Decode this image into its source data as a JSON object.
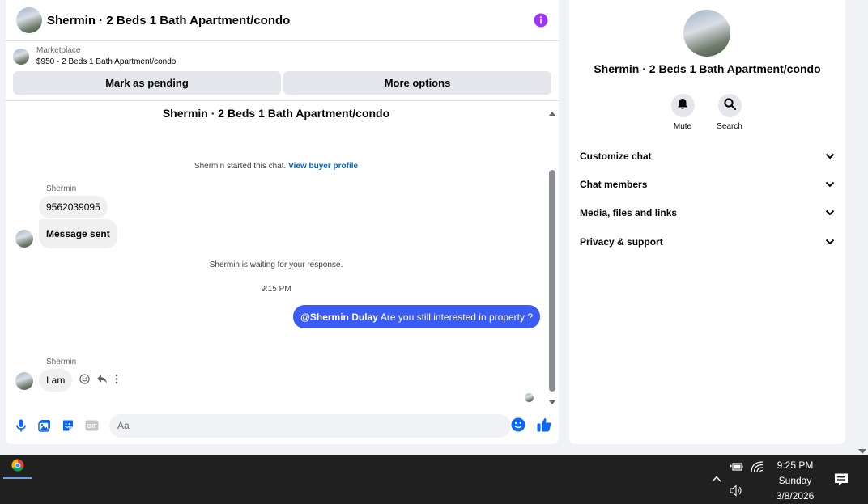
{
  "chat": {
    "title": "Shermin · 2 Beds 1 Bath Apartment/condo",
    "listing_source": "Marketplace",
    "listing_summary": "$950 - 2 Beds 1 Bath Apartment/condo",
    "mark_pending_label": "Mark as pending",
    "more_options_label": "More options"
  },
  "thread": {
    "title": "Shermin · 2 Beds 1 Bath Apartment/condo",
    "started_text": "Shermin started this chat.",
    "buyer_profile_link": "View buyer profile",
    "waiting_text": "Shermin is waiting for your response.",
    "time_separator": "9:15 PM",
    "messages": [
      {
        "sender": "Shermin",
        "text": "9562039095"
      },
      {
        "text": "Message sent"
      },
      {
        "mention": "@Shermin Dulay",
        "text": "Are you still interested in property ?"
      },
      {
        "sender": "Shermin",
        "text": "I am"
      }
    ]
  },
  "composer": {
    "placeholder": "Aa"
  },
  "details": {
    "name": "Shermin · 2 Beds 1 Bath Apartment/condo",
    "mute_label": "Mute",
    "search_label": "Search",
    "sections": [
      "Customize chat",
      "Chat members",
      "Media, files and links",
      "Privacy & support"
    ]
  },
  "taskbar": {
    "time": "9:25 PM",
    "day": "Sunday",
    "date": "3/8/2026"
  },
  "colors": {
    "accent": "#3b5bf5",
    "link": "#0064d1",
    "info": "#a033ff",
    "icon_blue": "#0866ff"
  },
  "icons": [
    "info-icon",
    "mic-icon",
    "photo-icon",
    "sticker-icon",
    "gif-icon",
    "emoji-icon",
    "like-icon",
    "bell-icon",
    "search-icon",
    "chevron-down-icon",
    "react-icon",
    "reply-icon",
    "more-icon",
    "chrome-icon",
    "battery-icon",
    "wifi-icon",
    "volume-icon",
    "notification-icon"
  ]
}
